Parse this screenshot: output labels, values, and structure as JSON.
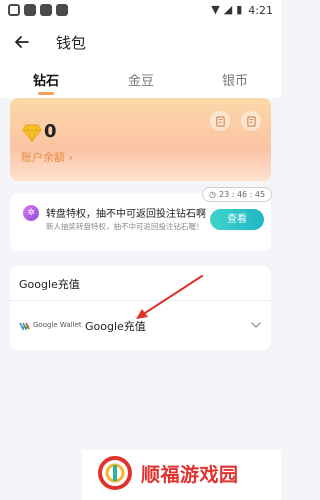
{
  "status_bar": {
    "time": "4:21"
  },
  "header": {
    "title": "钱包"
  },
  "tabs": [
    {
      "label": "钻石",
      "active": true
    },
    {
      "label": "金豆",
      "active": false
    },
    {
      "label": "银币",
      "active": false
    }
  ],
  "balance": {
    "amount": "0",
    "link_label": "账户余额 ›"
  },
  "promo": {
    "timer": "23 : 46 : 45",
    "title": "转盘特权，抽不中可返回投注钻石啊",
    "subtitle": "新人抽奖转盘特权，抽不中可返回投注钻石喔！",
    "button_label": "查看"
  },
  "google_pay": {
    "header": "Google充值",
    "wallet_label": "Google Wallet",
    "name": "Google充值"
  },
  "watermark": {
    "text": "顺福游戏园"
  },
  "colors": {
    "accent_orange": "#f3a05a",
    "teal_button": "#20b7c6",
    "annotation_red": "#e0322e"
  },
  "icons": {
    "back": "arrow-left-icon",
    "gem": "diamond-icon",
    "records": "receipt-icon",
    "chevron": "chevron-down-icon"
  }
}
